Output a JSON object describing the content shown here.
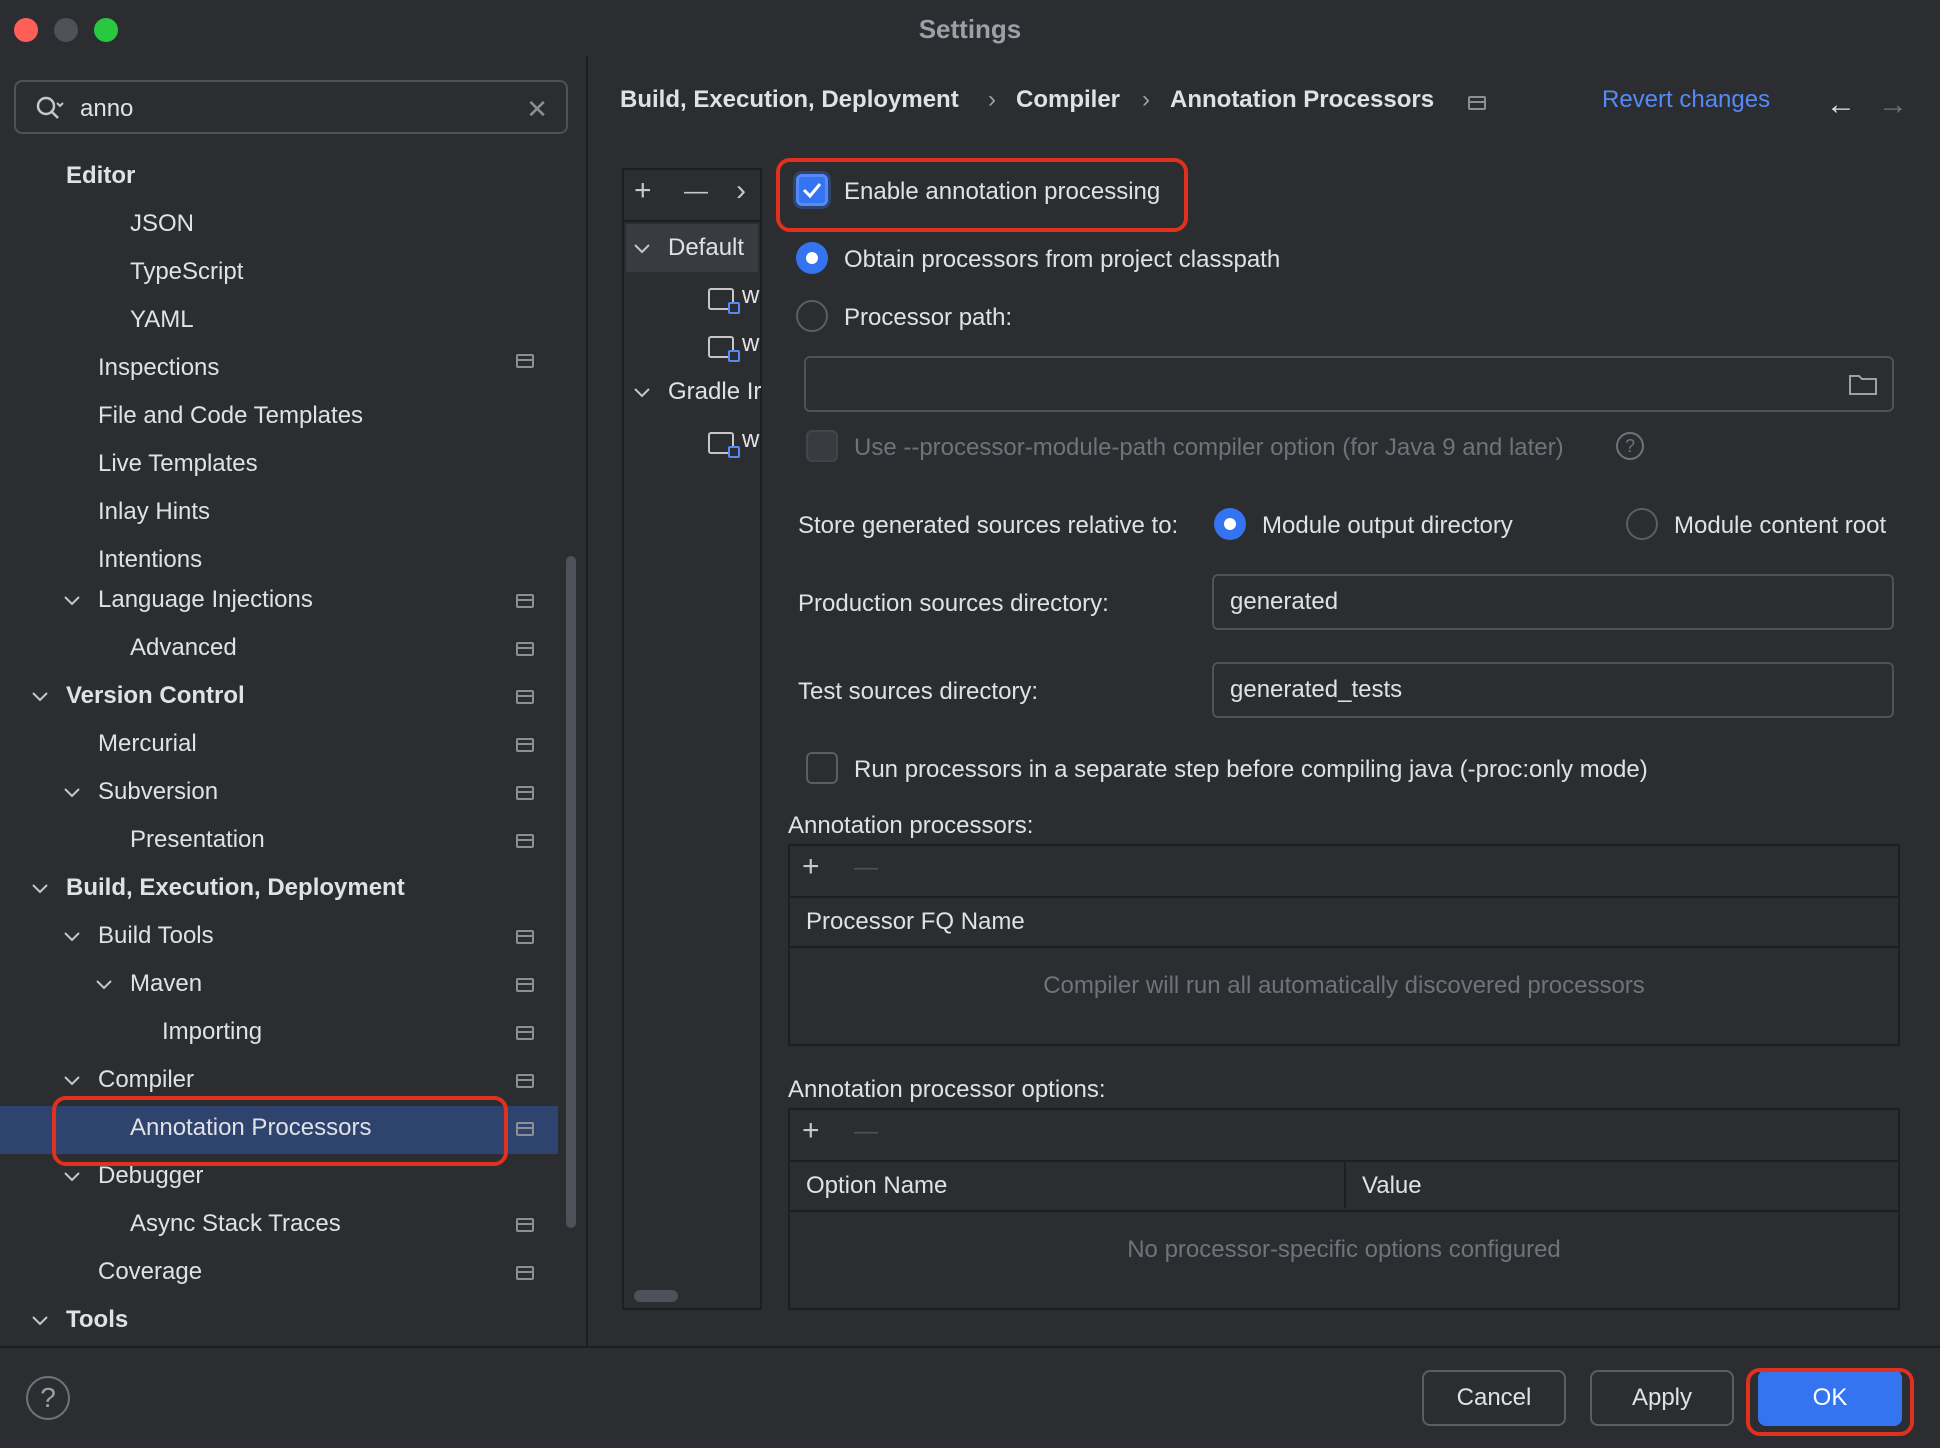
{
  "window": {
    "title": "Settings"
  },
  "search": {
    "value": "anno",
    "clear": "✕"
  },
  "sidebar": {
    "items": [
      {
        "label": "Editor"
      },
      {
        "label": "JSON"
      },
      {
        "label": "TypeScript"
      },
      {
        "label": "YAML"
      },
      {
        "label": "Inspections"
      },
      {
        "label": "File and Code Templates"
      },
      {
        "label": "Live Templates"
      },
      {
        "label": "Inlay Hints"
      },
      {
        "label": "Intentions"
      },
      {
        "label": "Language Injections"
      },
      {
        "label": "Advanced"
      },
      {
        "label": "Version Control"
      },
      {
        "label": "Mercurial"
      },
      {
        "label": "Subversion"
      },
      {
        "label": "Presentation"
      },
      {
        "label": "Build, Execution, Deployment"
      },
      {
        "label": "Build Tools"
      },
      {
        "label": "Maven"
      },
      {
        "label": "Importing"
      },
      {
        "label": "Compiler"
      },
      {
        "label": "Annotation Processors"
      },
      {
        "label": "Debugger"
      },
      {
        "label": "Async Stack Traces"
      },
      {
        "label": "Coverage"
      },
      {
        "label": "Tools"
      }
    ]
  },
  "breadcrumb": {
    "items": [
      "Build, Execution, Deployment",
      "Compiler",
      "Annotation Processors"
    ],
    "separator": "›",
    "revert": "Revert changes",
    "back": "←",
    "forward": "→"
  },
  "profiles": {
    "toolbar": {
      "add": "+",
      "remove": "—",
      "more": "›"
    },
    "items": [
      {
        "label": "Default"
      },
      {
        "label": "w"
      },
      {
        "label": "w"
      },
      {
        "label": "Gradle Ir"
      },
      {
        "label": "w"
      }
    ]
  },
  "form": {
    "enable_label": "Enable annotation processing",
    "enable_checked": true,
    "obtain_label": "Obtain processors from project classpath",
    "processor_path_label": "Processor path:",
    "processor_path_value": "",
    "module_path_label": "Use --processor-module-path compiler option (for Java 9 and later)",
    "help_glyph": "?",
    "store_label": "Store generated sources relative to:",
    "module_output_label": "Module output directory",
    "module_content_label": "Module content root",
    "production_label": "Production sources directory:",
    "production_value": "generated",
    "test_label": "Test sources directory:",
    "test_value": "generated_tests",
    "separate_step_label": "Run processors in a separate step before compiling java (-proc:only mode)"
  },
  "processors_table": {
    "title": "Annotation processors:",
    "add": "+",
    "remove": "—",
    "column": "Processor FQ Name",
    "empty": "Compiler will run all automatically discovered processors"
  },
  "options_table": {
    "title": "Annotation processor options:",
    "add": "+",
    "remove": "—",
    "columns": [
      "Option Name",
      "Value"
    ],
    "empty": "No processor-specific options configured"
  },
  "footer": {
    "help": "?",
    "cancel": "Cancel",
    "apply": "Apply",
    "ok": "OK"
  },
  "colors": {
    "accent": "#3574f0",
    "highlight": "#e0301e",
    "selection": "#2e436e",
    "background": "#2b2d30"
  }
}
